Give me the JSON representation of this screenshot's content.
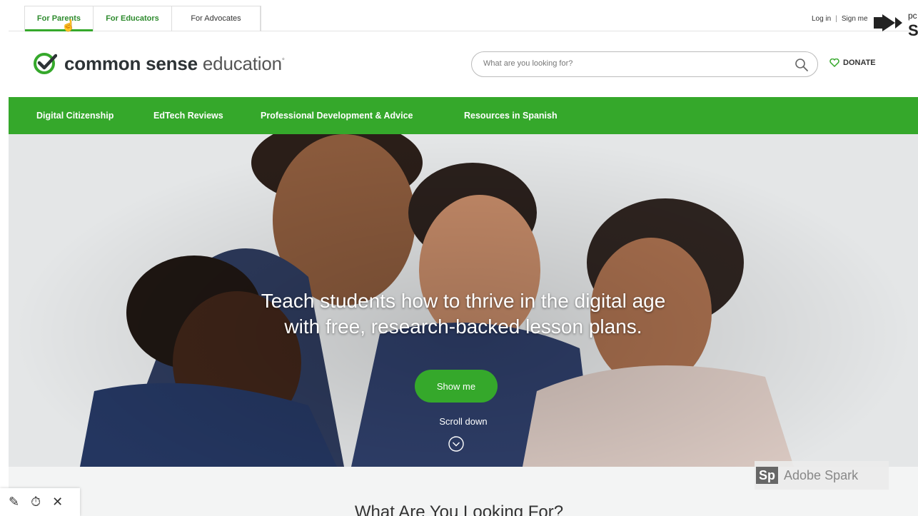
{
  "audience_tabs": [
    {
      "label": "For Parents",
      "active": true
    },
    {
      "label": "For Educators",
      "active": false
    },
    {
      "label": "For Advocates",
      "active": false
    }
  ],
  "auth": {
    "login": "Log in",
    "separator": "|",
    "signup": "Sign me"
  },
  "overlay_logo": {
    "line1": "pc",
    "line2": "S"
  },
  "brand": {
    "bold": "common sense",
    "light": "education",
    "mark": "°"
  },
  "search": {
    "placeholder": "What are you looking for?"
  },
  "donate_label": "DONATE",
  "nav": [
    "Digital Citizenship",
    "EdTech Reviews",
    "Professional Development & Advice",
    "Resources in Spanish"
  ],
  "hero": {
    "headline_line1": "Teach students how to thrive in the digital age",
    "headline_line2": "with free, research-backed lesson plans.",
    "cta": "Show me",
    "scroll": "Scroll down"
  },
  "watermark": {
    "badge": "Sp",
    "label": "Adobe Spark"
  },
  "next_section_title": "What Are You Looking For?",
  "video_controls": [
    "pen-icon",
    "timer-icon",
    "close-icon"
  ],
  "colors": {
    "brand_green": "#35a82b",
    "text_dark": "#2d3336"
  }
}
